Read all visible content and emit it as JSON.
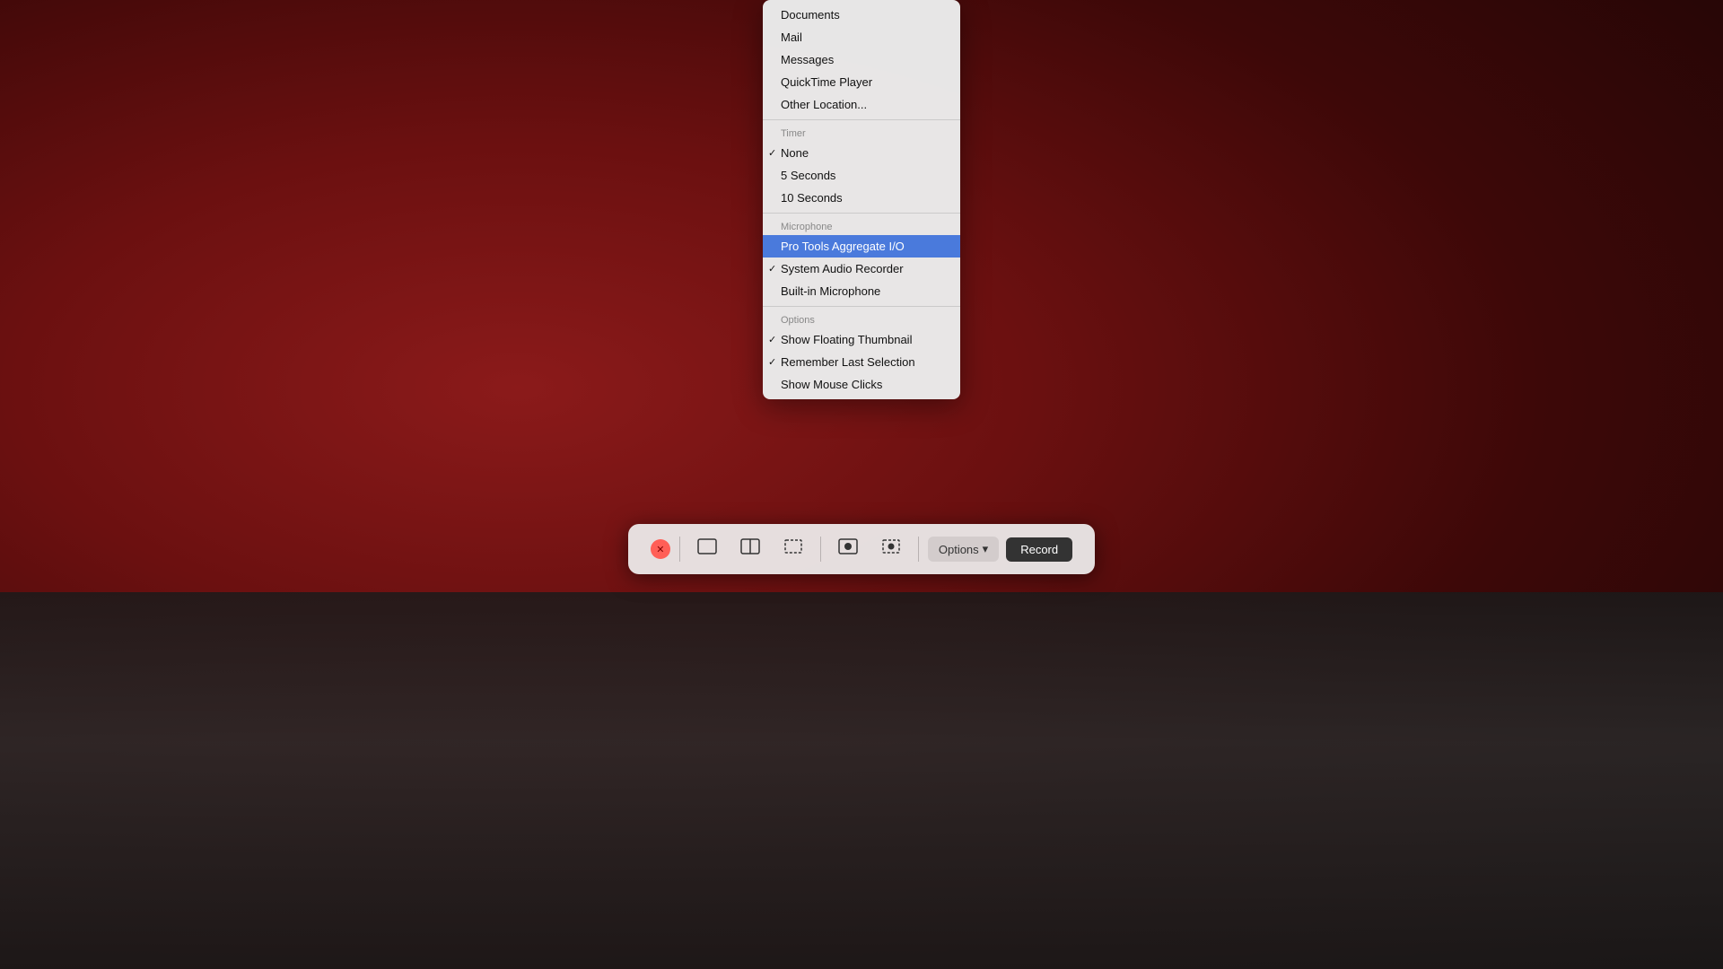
{
  "background": {
    "color": "#6b1010"
  },
  "toolbar": {
    "close_label": "✕",
    "options_label": "Options",
    "options_chevron": "▾",
    "record_label": "Record",
    "icons": [
      {
        "name": "capture-window",
        "symbol": "⬜"
      },
      {
        "name": "capture-window-split",
        "symbol": "⬛"
      },
      {
        "name": "capture-selection",
        "symbol": "⬚"
      },
      {
        "name": "capture-screen-record",
        "symbol": "⬤"
      },
      {
        "name": "capture-selection-record",
        "symbol": "⬚"
      }
    ]
  },
  "dropdown": {
    "sections": [
      {
        "label": null,
        "items": [
          {
            "text": "Documents",
            "checked": false,
            "highlighted": false
          },
          {
            "text": "Mail",
            "checked": false,
            "highlighted": false
          },
          {
            "text": "Messages",
            "checked": false,
            "highlighted": false
          },
          {
            "text": "QuickTime Player",
            "checked": false,
            "highlighted": false
          },
          {
            "text": "Other Location...",
            "checked": false,
            "highlighted": false
          }
        ]
      },
      {
        "label": "Timer",
        "items": [
          {
            "text": "None",
            "checked": true,
            "highlighted": false
          },
          {
            "text": "5 Seconds",
            "checked": false,
            "highlighted": false
          },
          {
            "text": "10 Seconds",
            "checked": false,
            "highlighted": false
          }
        ]
      },
      {
        "label": "Microphone",
        "items": [
          {
            "text": "Pro Tools Aggregate I/O",
            "checked": false,
            "highlighted": true
          },
          {
            "text": "System Audio Recorder",
            "checked": true,
            "highlighted": false
          },
          {
            "text": "Built-in Microphone",
            "checked": false,
            "highlighted": false
          }
        ]
      },
      {
        "label": "Options",
        "items": [
          {
            "text": "Show Floating Thumbnail",
            "checked": true,
            "highlighted": false
          },
          {
            "text": "Remember Last Selection",
            "checked": true,
            "highlighted": false
          },
          {
            "text": "Show Mouse Clicks",
            "checked": false,
            "highlighted": false
          }
        ]
      }
    ]
  }
}
